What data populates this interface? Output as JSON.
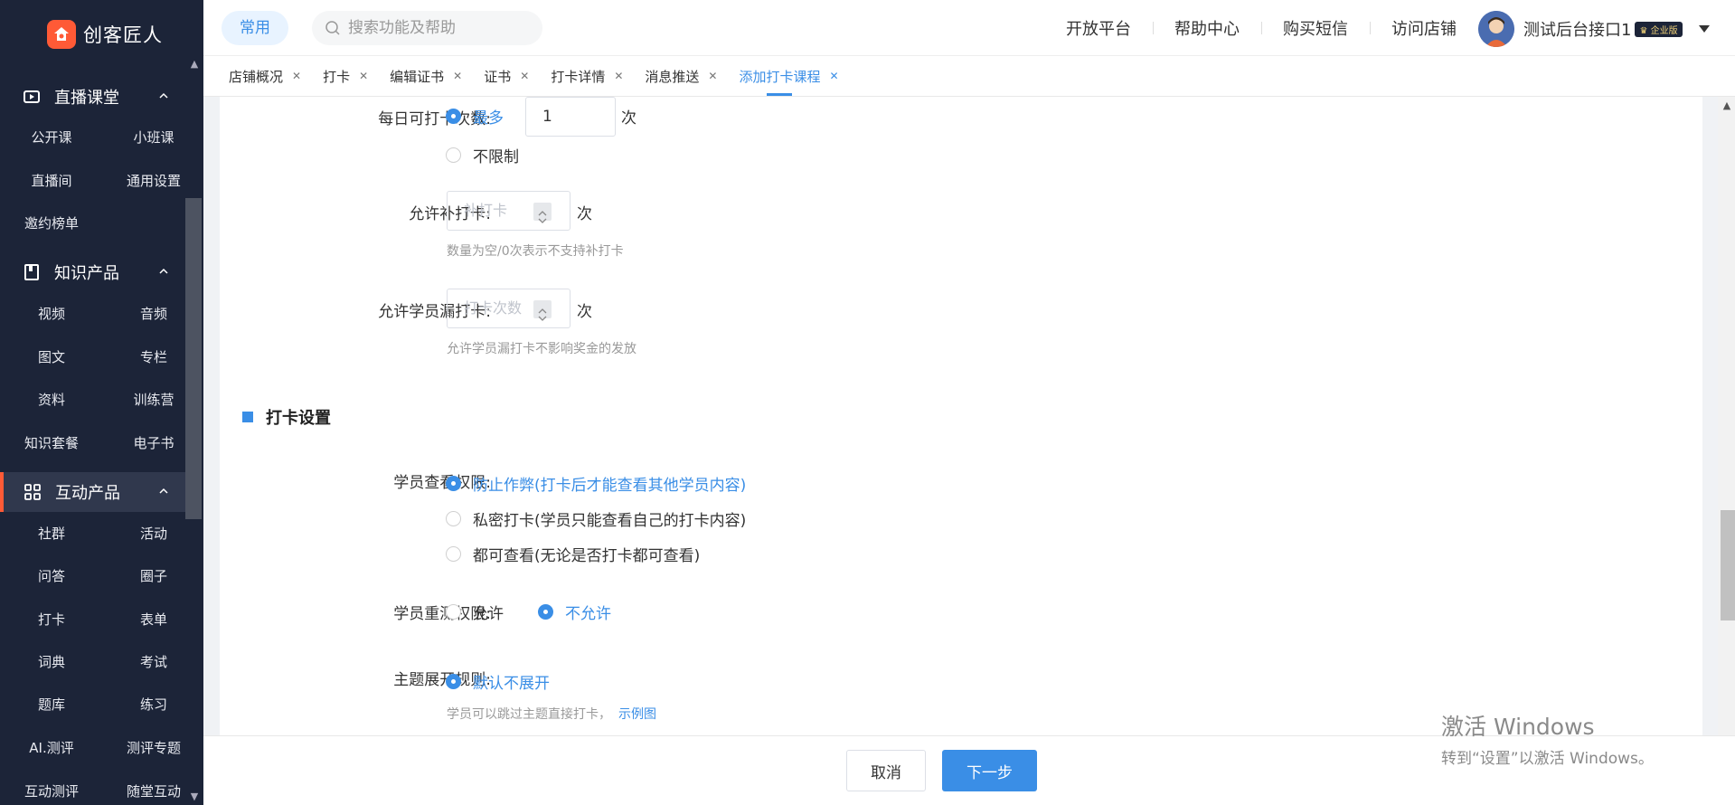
{
  "app": {
    "logo_text": "创客匠人"
  },
  "header": {
    "common_label": "常用",
    "search_placeholder": "搜索功能及帮助",
    "links": [
      "开放平台",
      "帮助中心",
      "购买短信",
      "访问店铺"
    ],
    "user_name": "测试后台接口1",
    "badge": "企业版"
  },
  "tabs": [
    {
      "label": "店铺概况"
    },
    {
      "label": "打卡"
    },
    {
      "label": "编辑证书"
    },
    {
      "label": "证书"
    },
    {
      "label": "打卡详情"
    },
    {
      "label": "消息推送"
    },
    {
      "label": "添加打卡课程",
      "active": true
    }
  ],
  "sidebar": {
    "groups": [
      {
        "label": "直播课堂",
        "items": [
          "公开课",
          "小班课",
          "直播间",
          "通用设置",
          "邀约榜单"
        ]
      },
      {
        "label": "知识产品",
        "items": [
          "视频",
          "音频",
          "图文",
          "专栏",
          "资料",
          "训练营",
          "知识套餐",
          "电子书"
        ]
      },
      {
        "label": "互动产品",
        "active": true,
        "items": [
          "社群",
          "活动",
          "问答",
          "圈子",
          "打卡",
          "表单",
          "词典",
          "考试",
          "题库",
          "练习",
          "AI.测评",
          "测评专题",
          "互动测评",
          "随堂互动"
        ]
      }
    ]
  },
  "form": {
    "daily_checkin": {
      "label": "每日可打卡次数:",
      "option_most": "最多",
      "value": "1",
      "unit": "次",
      "option_unlimited": "不限制"
    },
    "makeup_checkin": {
      "label": "允许补打卡:",
      "placeholder": "补打卡",
      "unit": "次",
      "hint": "数量为空/0次表示不支持补打卡"
    },
    "missed_checkin": {
      "label": "允许学员漏打卡:",
      "placeholder": "打卡次数",
      "unit": "次",
      "hint": "允许学员漏打卡不影响奖金的发放"
    },
    "section_title": "打卡设置",
    "view_permission": {
      "label": "学员查看权限:",
      "options": [
        "防止作弊(打卡后才能查看其他学员内容)",
        "私密打卡(学员只能查看自己的打卡内容)",
        "都可查看(无论是否打卡都可查看)"
      ],
      "selected": 0
    },
    "retest_permission": {
      "label": "学员重测权限:",
      "options": [
        "允许",
        "不允许"
      ],
      "selected": 1
    },
    "topic_expand": {
      "label": "主题展开规则:",
      "option": "默认不展开",
      "hint": "学员可以跳过主题直接打卡，",
      "hint_link": "示例图"
    }
  },
  "footer": {
    "cancel": "取消",
    "next": "下一步"
  },
  "watermark": {
    "line1": "激活 Windows",
    "line2": "转到“设置”以激活 Windows。"
  },
  "colors": {
    "accent": "#3a8ee6",
    "sidebar_bg": "#1c2438",
    "brand": "#ff5a36"
  }
}
